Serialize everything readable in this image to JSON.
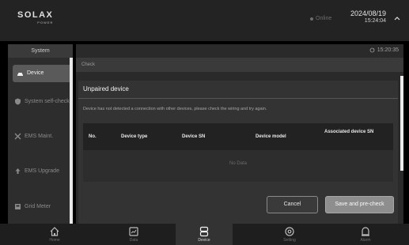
{
  "header": {
    "logo_main": "SOLAX",
    "logo_sub": "POWER",
    "status": "Online",
    "date": "2024/08/19",
    "time": "15:24:04"
  },
  "sidebar": {
    "title": "System",
    "items": [
      {
        "label": "Device",
        "icon": "device-icon",
        "active": true
      },
      {
        "label": "System self-check",
        "icon": "shield-check-icon",
        "active": false
      },
      {
        "label": "EMS Maint.",
        "icon": "tools-icon",
        "active": false
      },
      {
        "label": "EMS Upgrade",
        "icon": "upgrade-icon",
        "active": false
      },
      {
        "label": "Grid Meter",
        "icon": "meter-icon",
        "active": false
      }
    ]
  },
  "main": {
    "timestamp": "15:20:35",
    "breadcrumb": "Check",
    "panel_title": "Unpaired device",
    "message": "Device has not detected a connection with other devices, please check the wiring and try again.",
    "columns": [
      "No.",
      "Device type",
      "Device SN",
      "Device model",
      "Associated device SN"
    ],
    "no_data": "No Data",
    "cancel_label": "Cancel",
    "save_label": "Save and pre-check"
  },
  "tabs": [
    {
      "label": "Home",
      "icon": "home-icon"
    },
    {
      "label": "Data",
      "icon": "chart-icon"
    },
    {
      "label": "Device",
      "icon": "device-stack-icon",
      "active": true
    },
    {
      "label": "Setting",
      "icon": "gear-icon"
    },
    {
      "label": "Alarm",
      "icon": "alarm-icon"
    }
  ],
  "colors": {
    "background": "#000000",
    "panel": "#333333",
    "accent": "#8e8e8e"
  }
}
